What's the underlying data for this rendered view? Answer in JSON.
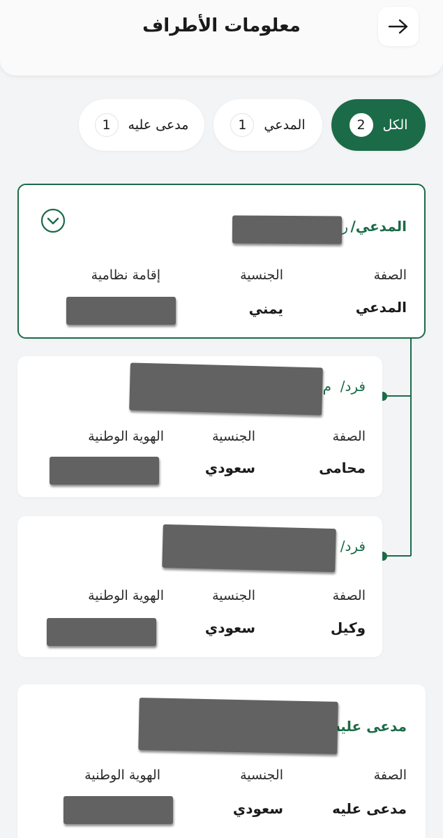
{
  "header": {
    "title": "معلومات  الأطراف",
    "back_icon": "arrow-right-icon"
  },
  "tabs": [
    {
      "label": "الكل",
      "count": "2",
      "active": true
    },
    {
      "label": "المدعي",
      "count": "1",
      "active": false
    },
    {
      "label": "مدعى عليه",
      "count": "1",
      "active": false
    }
  ],
  "colors": {
    "brand": "#1b6b48",
    "redaction": "#626262"
  },
  "field_labels": {
    "role": "الصفة",
    "nationality": "الجنسية",
    "residency": "إقامة نظامية",
    "national_id": "الهوية الوطنية"
  },
  "parties": [
    {
      "heading": "المدعي/",
      "heading_fragment": "ر",
      "role": "المدعي",
      "nationality": "يمني",
      "expand_icon": "chevron-down-circle-icon"
    },
    {
      "heading": "فرد/",
      "heading_fragment": "م",
      "role": "محامى",
      "nationality": "سعودي"
    },
    {
      "heading": "فرد/",
      "role": "وكيل",
      "nationality": "سعودي"
    },
    {
      "heading": "مدعى عليه/",
      "role": "مدعى عليه",
      "nationality": "سعودي"
    }
  ]
}
